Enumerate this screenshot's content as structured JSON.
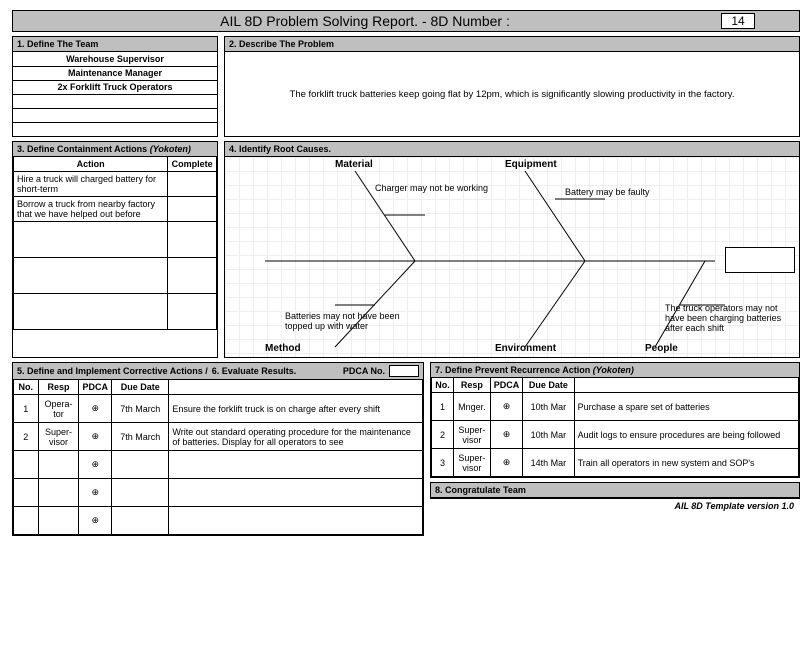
{
  "title": "AIL 8D Problem Solving Report. - 8D Number :",
  "report_number": "14",
  "s1": {
    "hdr": "1. Define The Team",
    "rows": [
      "Warehouse Supervisor",
      "Maintenance Manager",
      "2x Forklift Truck Operators",
      "",
      "",
      ""
    ]
  },
  "s2": {
    "hdr": "2. Describe The Problem",
    "body": "The forklift truck batteries keep going flat by 12pm, which is significantly slowing productivity in the factory."
  },
  "s3": {
    "hdr": "3. Define Containment Actions",
    "hdr_it": "(Yokoten)",
    "cols": {
      "action": "Action",
      "complete": "Complete"
    },
    "rows": [
      {
        "a": "Hire a truck will charged battery for short-term",
        "c": ""
      },
      {
        "a": "Borrow a truck from nearby factory that we have helped out before",
        "c": ""
      },
      {
        "a": "",
        "c": ""
      },
      {
        "a": "",
        "c": ""
      },
      {
        "a": "",
        "c": ""
      }
    ]
  },
  "s4": {
    "hdr": "4. Identify Root Causes.",
    "cats": {
      "material": "Material",
      "equipment": "Equipment",
      "method": "Method",
      "environment": "Environment",
      "people": "People"
    },
    "notes": {
      "charger": "Charger may not be working",
      "battery": "Battery may be faulty",
      "water": "Batteries may not have been topped up with water",
      "ops": "The truck operators may not have been charging batteries after each shift"
    }
  },
  "s5": {
    "hdr5a": "5. Define and Implement Corrective Actions /",
    "hdr5b": "6. Evaluate Results.",
    "pdca_lbl": "PDCA No.",
    "cols": {
      "no": "No.",
      "resp": "Resp",
      "pdca": "PDCA",
      "due": "Due Date"
    },
    "rows": [
      {
        "no": "1",
        "resp": "Opera-tor",
        "due": "7th March",
        "act": "Ensure the forklift truck is on charge after every shift"
      },
      {
        "no": "2",
        "resp": "Super-visor",
        "due": "7th March",
        "act": "Write out standard operating procedure for the maintenance of batteries. Display for all operators to see"
      },
      {
        "no": "",
        "resp": "",
        "due": "",
        "act": ""
      },
      {
        "no": "",
        "resp": "",
        "due": "",
        "act": ""
      },
      {
        "no": "",
        "resp": "",
        "due": "",
        "act": ""
      }
    ]
  },
  "s7": {
    "hdr": "7. Define Prevent Recurrence Action",
    "hdr_it": "(Yokoten)",
    "cols": {
      "no": "No.",
      "resp": "Resp",
      "pdca": "PDCA",
      "due": "Due Date"
    },
    "rows": [
      {
        "no": "1",
        "resp": "Mnger.",
        "due": "10th Mar",
        "act": "Purchase a spare set of batteries"
      },
      {
        "no": "2",
        "resp": "Super-visor",
        "due": "10th Mar",
        "act": "Audit logs to ensure procedures are being followed"
      },
      {
        "no": "3",
        "resp": "Super-visor",
        "due": "14th Mar",
        "act": "Train all operators in new system and SOP's"
      }
    ]
  },
  "s8": {
    "hdr": "8. Congratulate Team"
  },
  "footer": "AIL 8D Template version 1.0",
  "pdca_glyph": "⊕"
}
